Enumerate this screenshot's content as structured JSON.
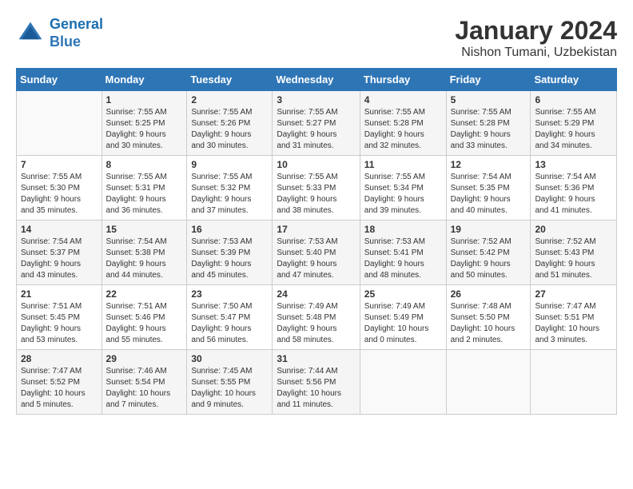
{
  "header": {
    "logo_line1": "General",
    "logo_line2": "Blue",
    "month_year": "January 2024",
    "location": "Nishon Tumani, Uzbekistan"
  },
  "columns": [
    "Sunday",
    "Monday",
    "Tuesday",
    "Wednesday",
    "Thursday",
    "Friday",
    "Saturday"
  ],
  "weeks": [
    [
      {
        "day": "",
        "info": ""
      },
      {
        "day": "1",
        "info": "Sunrise: 7:55 AM\nSunset: 5:25 PM\nDaylight: 9 hours\nand 30 minutes."
      },
      {
        "day": "2",
        "info": "Sunrise: 7:55 AM\nSunset: 5:26 PM\nDaylight: 9 hours\nand 30 minutes."
      },
      {
        "day": "3",
        "info": "Sunrise: 7:55 AM\nSunset: 5:27 PM\nDaylight: 9 hours\nand 31 minutes."
      },
      {
        "day": "4",
        "info": "Sunrise: 7:55 AM\nSunset: 5:28 PM\nDaylight: 9 hours\nand 32 minutes."
      },
      {
        "day": "5",
        "info": "Sunrise: 7:55 AM\nSunset: 5:28 PM\nDaylight: 9 hours\nand 33 minutes."
      },
      {
        "day": "6",
        "info": "Sunrise: 7:55 AM\nSunset: 5:29 PM\nDaylight: 9 hours\nand 34 minutes."
      }
    ],
    [
      {
        "day": "7",
        "info": "Sunrise: 7:55 AM\nSunset: 5:30 PM\nDaylight: 9 hours\nand 35 minutes."
      },
      {
        "day": "8",
        "info": "Sunrise: 7:55 AM\nSunset: 5:31 PM\nDaylight: 9 hours\nand 36 minutes."
      },
      {
        "day": "9",
        "info": "Sunrise: 7:55 AM\nSunset: 5:32 PM\nDaylight: 9 hours\nand 37 minutes."
      },
      {
        "day": "10",
        "info": "Sunrise: 7:55 AM\nSunset: 5:33 PM\nDaylight: 9 hours\nand 38 minutes."
      },
      {
        "day": "11",
        "info": "Sunrise: 7:55 AM\nSunset: 5:34 PM\nDaylight: 9 hours\nand 39 minutes."
      },
      {
        "day": "12",
        "info": "Sunrise: 7:54 AM\nSunset: 5:35 PM\nDaylight: 9 hours\nand 40 minutes."
      },
      {
        "day": "13",
        "info": "Sunrise: 7:54 AM\nSunset: 5:36 PM\nDaylight: 9 hours\nand 41 minutes."
      }
    ],
    [
      {
        "day": "14",
        "info": "Sunrise: 7:54 AM\nSunset: 5:37 PM\nDaylight: 9 hours\nand 43 minutes."
      },
      {
        "day": "15",
        "info": "Sunrise: 7:54 AM\nSunset: 5:38 PM\nDaylight: 9 hours\nand 44 minutes."
      },
      {
        "day": "16",
        "info": "Sunrise: 7:53 AM\nSunset: 5:39 PM\nDaylight: 9 hours\nand 45 minutes."
      },
      {
        "day": "17",
        "info": "Sunrise: 7:53 AM\nSunset: 5:40 PM\nDaylight: 9 hours\nand 47 minutes."
      },
      {
        "day": "18",
        "info": "Sunrise: 7:53 AM\nSunset: 5:41 PM\nDaylight: 9 hours\nand 48 minutes."
      },
      {
        "day": "19",
        "info": "Sunrise: 7:52 AM\nSunset: 5:42 PM\nDaylight: 9 hours\nand 50 minutes."
      },
      {
        "day": "20",
        "info": "Sunrise: 7:52 AM\nSunset: 5:43 PM\nDaylight: 9 hours\nand 51 minutes."
      }
    ],
    [
      {
        "day": "21",
        "info": "Sunrise: 7:51 AM\nSunset: 5:45 PM\nDaylight: 9 hours\nand 53 minutes."
      },
      {
        "day": "22",
        "info": "Sunrise: 7:51 AM\nSunset: 5:46 PM\nDaylight: 9 hours\nand 55 minutes."
      },
      {
        "day": "23",
        "info": "Sunrise: 7:50 AM\nSunset: 5:47 PM\nDaylight: 9 hours\nand 56 minutes."
      },
      {
        "day": "24",
        "info": "Sunrise: 7:49 AM\nSunset: 5:48 PM\nDaylight: 9 hours\nand 58 minutes."
      },
      {
        "day": "25",
        "info": "Sunrise: 7:49 AM\nSunset: 5:49 PM\nDaylight: 10 hours\nand 0 minutes."
      },
      {
        "day": "26",
        "info": "Sunrise: 7:48 AM\nSunset: 5:50 PM\nDaylight: 10 hours\nand 2 minutes."
      },
      {
        "day": "27",
        "info": "Sunrise: 7:47 AM\nSunset: 5:51 PM\nDaylight: 10 hours\nand 3 minutes."
      }
    ],
    [
      {
        "day": "28",
        "info": "Sunrise: 7:47 AM\nSunset: 5:52 PM\nDaylight: 10 hours\nand 5 minutes."
      },
      {
        "day": "29",
        "info": "Sunrise: 7:46 AM\nSunset: 5:54 PM\nDaylight: 10 hours\nand 7 minutes."
      },
      {
        "day": "30",
        "info": "Sunrise: 7:45 AM\nSunset: 5:55 PM\nDaylight: 10 hours\nand 9 minutes."
      },
      {
        "day": "31",
        "info": "Sunrise: 7:44 AM\nSunset: 5:56 PM\nDaylight: 10 hours\nand 11 minutes."
      },
      {
        "day": "",
        "info": ""
      },
      {
        "day": "",
        "info": ""
      },
      {
        "day": "",
        "info": ""
      }
    ]
  ]
}
